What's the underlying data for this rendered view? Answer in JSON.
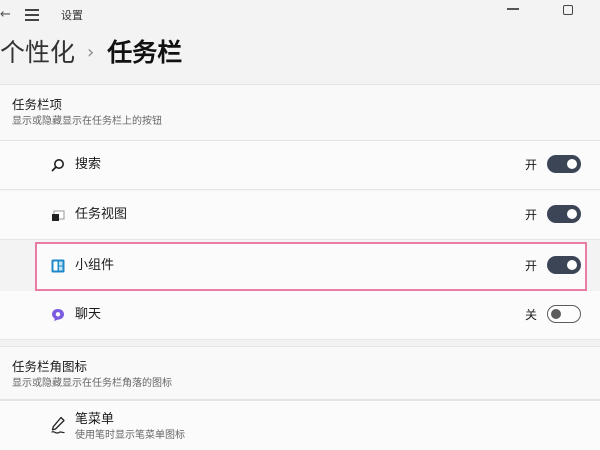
{
  "window": {
    "app_title": "设置"
  },
  "breadcrumb": {
    "parent": "个性化",
    "separator": "›",
    "current": "任务栏"
  },
  "sections": [
    {
      "title": "任务栏项",
      "subtitle": "显示或隐藏显示在任务栏上的按钮",
      "items": [
        {
          "label": "搜索",
          "state": "开",
          "toggle_on": true,
          "icon": "search-icon"
        },
        {
          "label": "任务视图",
          "state": "开",
          "toggle_on": true,
          "icon": "task-view-icon"
        },
        {
          "label": "小组件",
          "state": "开",
          "toggle_on": true,
          "icon": "widgets-icon",
          "highlighted": true
        },
        {
          "label": "聊天",
          "state": "关",
          "toggle_on": false,
          "icon": "chat-icon"
        }
      ]
    },
    {
      "title": "任务栏角图标",
      "subtitle": "显示或隐藏显示在任务栏角落的图标",
      "items": [
        {
          "label": "笔菜单",
          "subtitle": "使用笔时显示笔菜单图标",
          "icon": "pen-icon"
        }
      ]
    }
  ],
  "colors": {
    "toggle_on": "#3b4556",
    "highlight_border": "#e97ca4",
    "widgets_icon": "#1e88c8",
    "chat_icon": "#7b5ce1"
  }
}
